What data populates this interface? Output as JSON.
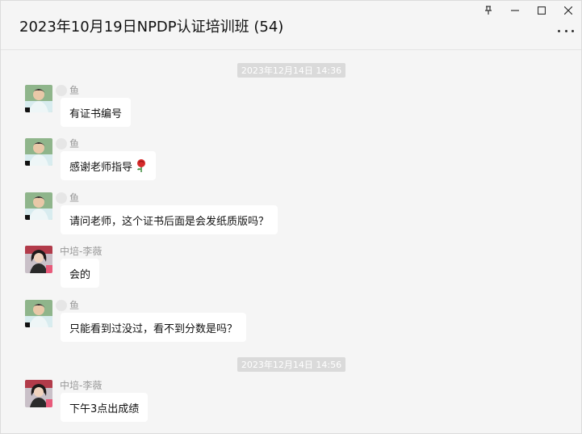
{
  "window": {
    "title": "2023年10月19日NPDP认证培训班 (54)",
    "controls": {
      "pin": "⚲",
      "minimize": "—",
      "maximize": "☐",
      "close": "✕"
    }
  },
  "timestamps": [
    "2023年12月14日 14:36",
    "2023年12月14日 14:56"
  ],
  "messages": [
    {
      "sender": "鱼",
      "text": "有证书编号",
      "avatar": "avatar-man"
    },
    {
      "sender": "鱼",
      "text": "感谢老师指导",
      "avatar": "avatar-man",
      "emoji": "rose-icon"
    },
    {
      "sender": "鱼",
      "text": "请问老师，这个证书后面是会发纸质版吗？",
      "avatar": "avatar-man"
    },
    {
      "sender": "中培-李薇",
      "text": "会的",
      "avatar": "avatar-woman"
    },
    {
      "sender": "鱼",
      "text": "只能看到过没过，看不到分数是吗？",
      "avatar": "avatar-man"
    },
    {
      "sender": "中培-李薇",
      "text": "下午3点出成绩",
      "avatar": "avatar-woman"
    }
  ]
}
